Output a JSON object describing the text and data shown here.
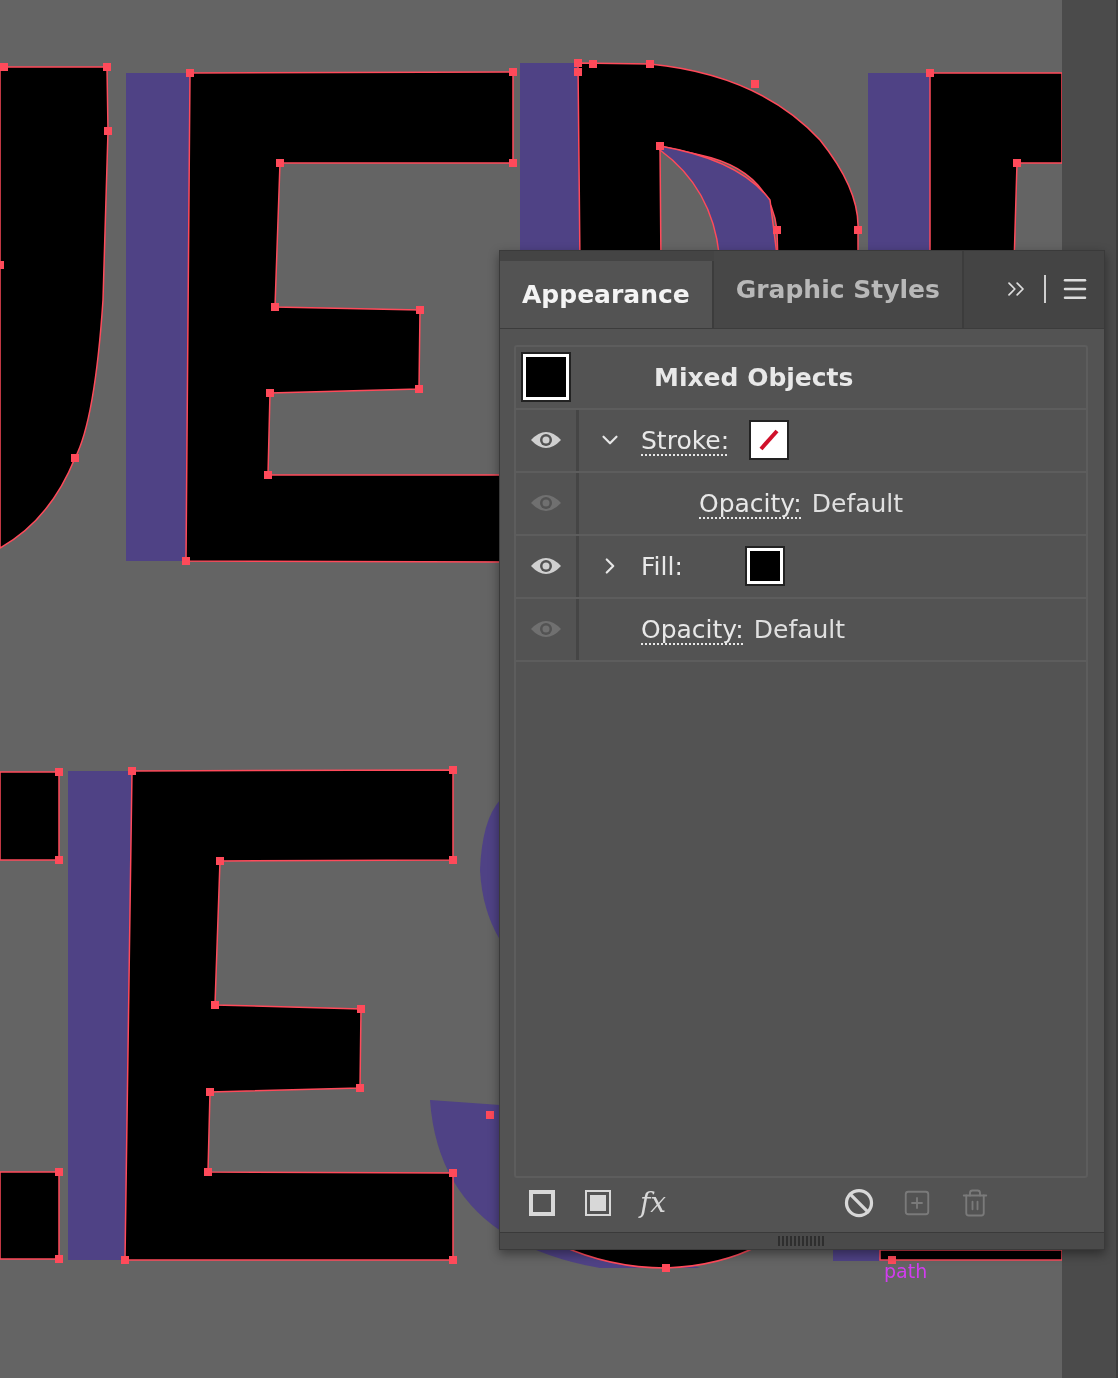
{
  "tabs": [
    {
      "label": "Appearance",
      "selected": true
    },
    {
      "label": "Graphic Styles",
      "selected": false
    }
  ],
  "header": {
    "title": "Mixed Objects"
  },
  "rows": [
    {
      "kind": "stroke",
      "label": "Stroke:",
      "visible": true,
      "expanded": true,
      "children": [
        {
          "kind": "opacity",
          "label": "Opacity:",
          "value": "Default",
          "visible": false
        }
      ]
    },
    {
      "kind": "fill",
      "label": "Fill:",
      "visible": true,
      "expanded": false
    },
    {
      "kind": "opacity",
      "label": "Opacity:",
      "value": "Default",
      "visible": false
    }
  ],
  "toolbar": [
    {
      "kind": "new-stroke",
      "disabled": false
    },
    {
      "kind": "new-fill",
      "disabled": false
    },
    {
      "kind": "effects",
      "label": "fx",
      "disabled": false
    },
    {
      "kind": "clear",
      "disabled": false
    },
    {
      "kind": "duplicate",
      "disabled": true
    },
    {
      "kind": "delete",
      "disabled": true
    }
  ],
  "canvas_label": "path"
}
